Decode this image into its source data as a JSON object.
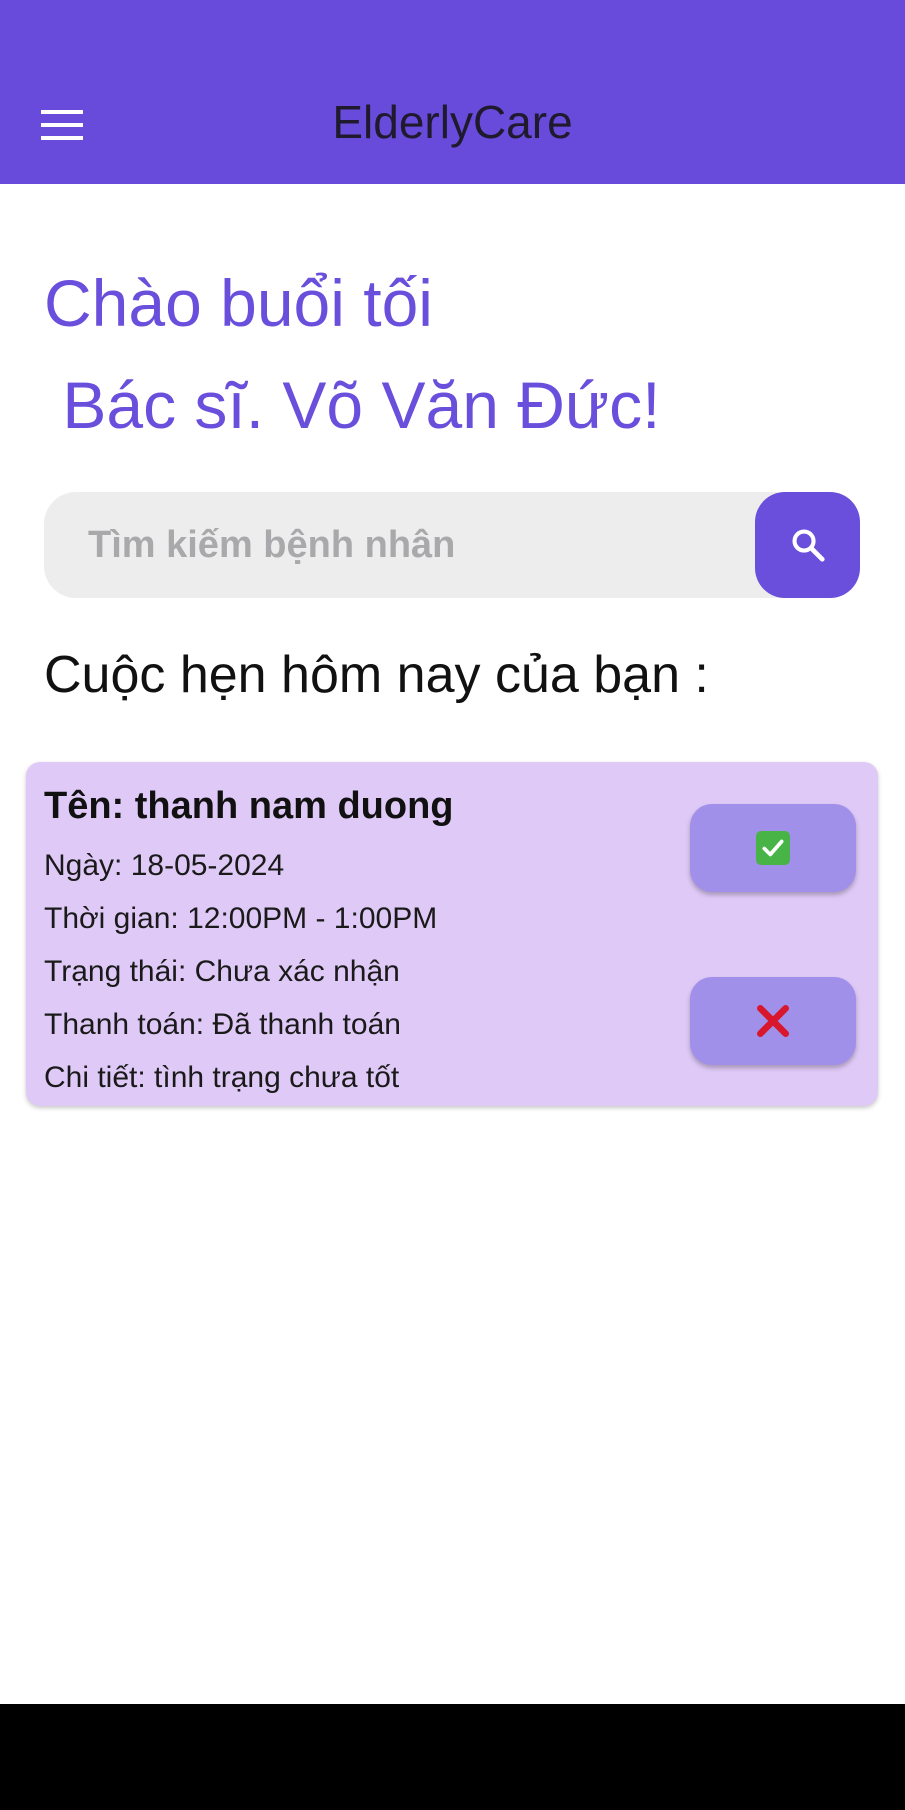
{
  "app_bar": {
    "title": "ElderlyCare",
    "menu_icon": "hamburger-menu-icon",
    "background": "#694bdb"
  },
  "greeting": {
    "line1": "Chào buổi tối",
    "line2": " Bác sĩ. Võ Văn Đức!"
  },
  "search": {
    "placeholder": "Tìm kiếm bệnh nhân",
    "value": "",
    "button_icon": "search-icon"
  },
  "appointments_section": {
    "title": "Cuộc hẹn hôm nay của bạn :"
  },
  "appointments": [
    {
      "name": "Tên: thanh nam duong",
      "date": "Ngày: 18-05-2024",
      "time": "Thời gian: 12:00PM - 1:00PM",
      "status": "Trạng thái: Chưa xác nhận",
      "payment": "Thanh toán: Đã thanh toán",
      "details": "Chi tiết: tình trạng chưa tốt",
      "confirm_icon": "check-mark-icon",
      "reject_icon": "cross-mark-icon"
    }
  ],
  "colors": {
    "accent": "#6a4fdc",
    "card_background": "#dfc9f7",
    "action_button": "#a190ea",
    "search_background": "#ededee"
  }
}
